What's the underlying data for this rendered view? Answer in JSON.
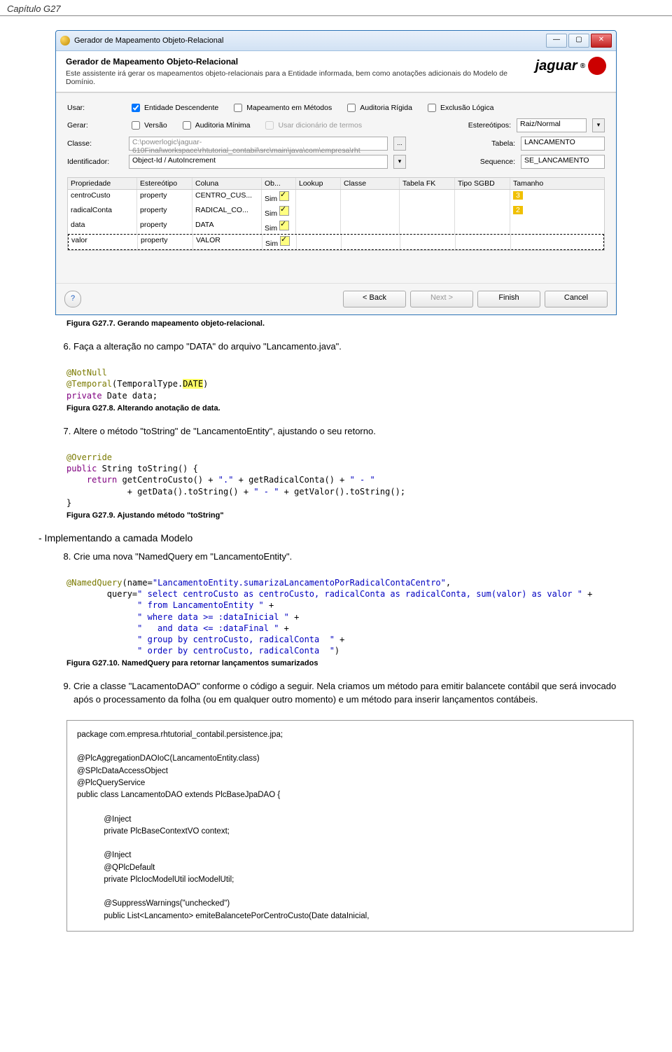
{
  "page_header": "Capítulo G27",
  "wizard": {
    "titlebar": "Gerador de Mapeamento Objeto-Relacional",
    "head_title": "Gerador de Mapeamento Objeto-Relacional",
    "head_sub": "Este assistente irá gerar os mapeamentos objeto-relacionais para a Entidade informada, bem como anotações adicionais do Modelo de Domínio.",
    "logo": "jaguar",
    "labels": {
      "usar": "Usar:",
      "gerar": "Gerar:",
      "classe": "Classe:",
      "ident": "Identificador:",
      "estereotipos": "Estereótipos:",
      "tabela": "Tabela:",
      "sequence": "Sequence:"
    },
    "checks": {
      "ent_desc": "Entidade Descendente",
      "map_met": "Mapeamento em Métodos",
      "aud_rig": "Auditoria Rígida",
      "excl_log": "Exclusão Lógica",
      "versao": "Versão",
      "aud_min": "Auditoria Mínima",
      "usar_dic": "Usar dicionário de termos"
    },
    "fields": {
      "classe": "C:\\powerlogic\\jaguar-610Final\\workspace\\rhtutorial_contabil\\src\\main\\java\\com\\empresa\\rht",
      "ident": "Object-Id / AutoIncrement",
      "estereotipos_ddl": "Raiz/Normal",
      "tabela": "LANCAMENTO",
      "sequence": "SE_LANCAMENTO"
    },
    "table": {
      "headers": [
        "Propriedade",
        "Estereótipo",
        "Coluna",
        "Ob...",
        "Lookup",
        "Classe",
        "Tabela FK",
        "Tipo SGBD",
        "Tamanho"
      ],
      "rows": [
        {
          "prop": "centroCusto",
          "est": "property",
          "col": "CENTRO_CUS...",
          "ob": "Sim",
          "tam": "3"
        },
        {
          "prop": "radicalConta",
          "est": "property",
          "col": "RADICAL_CO...",
          "ob": "Sim",
          "tam": "2"
        },
        {
          "prop": "data",
          "est": "property",
          "col": "DATA",
          "ob": "Sim",
          "tam": ""
        },
        {
          "prop": "valor",
          "est": "property",
          "col": "VALOR",
          "ob": "Sim",
          "tam": ""
        }
      ]
    },
    "buttons": {
      "back": "< Back",
      "next": "Next >",
      "finish": "Finish",
      "cancel": "Cancel"
    }
  },
  "cap7": "Figura G27.7. Gerando mapeamento objeto-relacional.",
  "item6": "Faça a alteração no campo \"DATA\" do arquivo \"Lancamento.java\".",
  "snippet8": {
    "l1a": "@NotNull",
    "l2a": "@Temporal",
    "l2b": "(TemporalType.",
    "l2c": "DATE",
    "l2d": ")",
    "l3a": "private",
    "l3b": " Date data;"
  },
  "cap8": "Figura G27.8. Alterando anotação de data.",
  "item7": "Altere o método \"toString\" de \"LancamentoEntity\", ajustando o seu retorno.",
  "snippet9": {
    "l1": "@Override",
    "l2a": "public",
    "l2b": " String toString() {",
    "l3a": "    return",
    "l3b": " getCentroCusto() + ",
    "l3c": "\".\"",
    "l3d": " + getRadicalConta() + ",
    "l3e": "\" - \"",
    "l4a": "            + getData().toString() + ",
    "l4b": "\" - \"",
    "l4c": " + getValor().toString();",
    "l5": "}"
  },
  "cap9": "Figura G27.9. Ajustando método \"toString\"",
  "subhead": "- Implementando a camada Modelo",
  "item8": "Crie uma nova \"NamedQuery em \"LancamentoEntity\".",
  "snippet10": {
    "l1a": "@NamedQuery",
    "l1b": "(name=",
    "l1c": "\"LancamentoEntity.sumarizaLancamentoPorRadicalContaCentro\"",
    "l1d": ",",
    "l2a": "        query=",
    "l2b": "\" select centroCusto as centroCusto, radicalConta as radicalConta, sum(valor) as valor \"",
    "l2c": " +",
    "l3a": "              ",
    "l3b": "\" from LancamentoEntity \"",
    "l3c": " +",
    "l4a": "              ",
    "l4b": "\" where data >= :dataInicial \"",
    "l4c": " +",
    "l5a": "              ",
    "l5b": "\"   and data <= :dataFinal \"",
    "l5c": " +",
    "l6a": "              ",
    "l6b": "\" group by centroCusto, radicalConta  \"",
    "l6c": " +",
    "l7a": "              ",
    "l7b": "\" order by centroCusto, radicalConta  \"",
    "l7c": ")"
  },
  "cap10": "Figura G27.10. NamedQuery para retornar lançamentos sumarizados",
  "item9": "Crie a classe \"LacamentoDAO\" conforme o código a seguir. Nela criamos um método para emitir balancete contábil que será invocado após o processamento da folha (ou em qualquer outro momento) e um método para inserir lançamentos contábeis.",
  "code": {
    "l1": "package com.empresa.rhtutorial_contabil.persistence.jpa;",
    "l2": "",
    "l3": "@PlcAggregationDAOIoC(LancamentoEntity.class)",
    "l4": "@SPlcDataAccessObject",
    "l5": "@PlcQueryService",
    "l6": "public class LancamentoDAO extends PlcBaseJpaDAO {",
    "l7": "",
    "l8": "            @Inject",
    "l9": "            private PlcBaseContextVO context;",
    "l10": "",
    "l11": "            @Inject",
    "l12": "            @QPlcDefault",
    "l13": "            private PlcIocModelUtil iocModelUtil;",
    "l14": "",
    "l15": "            @SuppressWarnings(\"unchecked\")",
    "l16": "            public List<Lancamento> emiteBalancetePorCentroCusto(Date dataInicial,"
  }
}
